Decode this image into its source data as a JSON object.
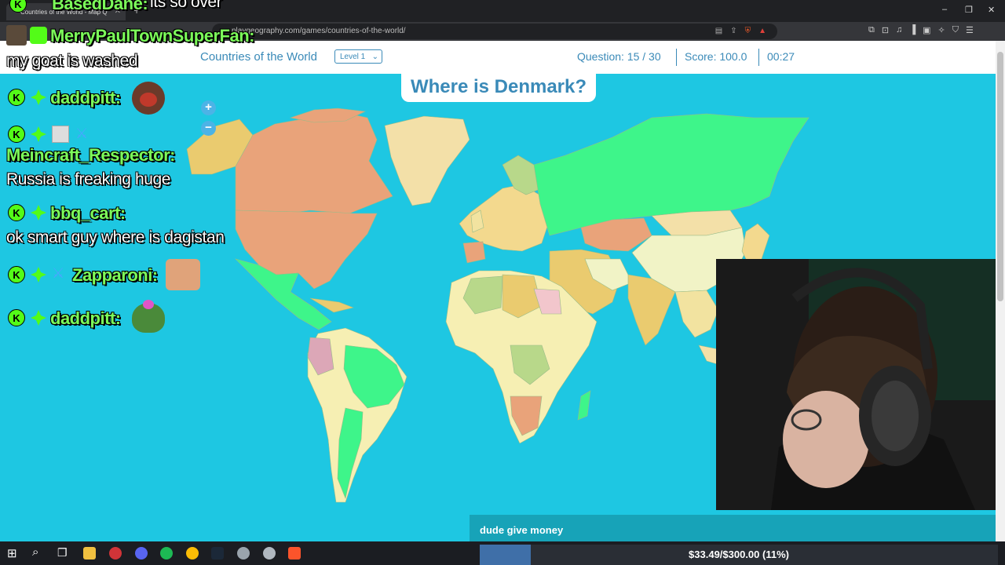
{
  "browser": {
    "tab_title": "Countries of the World - Map Q",
    "url": "playgeography.com/games/countries-of-the-world/",
    "minimize": "–",
    "maximize": "❐",
    "close": "✕"
  },
  "game": {
    "title": "Countries of the World",
    "level_selected": "Level 1",
    "question_progress": "Question: 15 / 30",
    "score": "Score: 100.0",
    "timer": "00:27",
    "prompt": "Where is Denmark?",
    "zoom_in": "+",
    "zoom_out": "−"
  },
  "chat": {
    "top_name": "BasedDane:",
    "top_msg": "its so over",
    "messages": [
      {
        "name": "MerryPaulTownSuperFan:",
        "text": "my goat is washed"
      },
      {
        "name": "daddpitt:",
        "text": ""
      },
      {
        "name": "Meincraft_Respector:",
        "text": "Russia is freaking huge"
      },
      {
        "name": "bbq_cart:",
        "text": "ok smart guy where is dagistan"
      },
      {
        "name": "Zapparoni:",
        "text": ""
      },
      {
        "name": "daddpitt:",
        "text": ""
      }
    ]
  },
  "overlay": {
    "donation_message": "dude give money",
    "goal_text": "$33.49/$300.00 (11%)",
    "goal_fraction": 0.11
  },
  "colors": {
    "ocean": "#1ec7e2",
    "header_text": "#3a8ab8",
    "highlight_green": "#3ef58a",
    "chat_name": "#7cfc5a"
  }
}
